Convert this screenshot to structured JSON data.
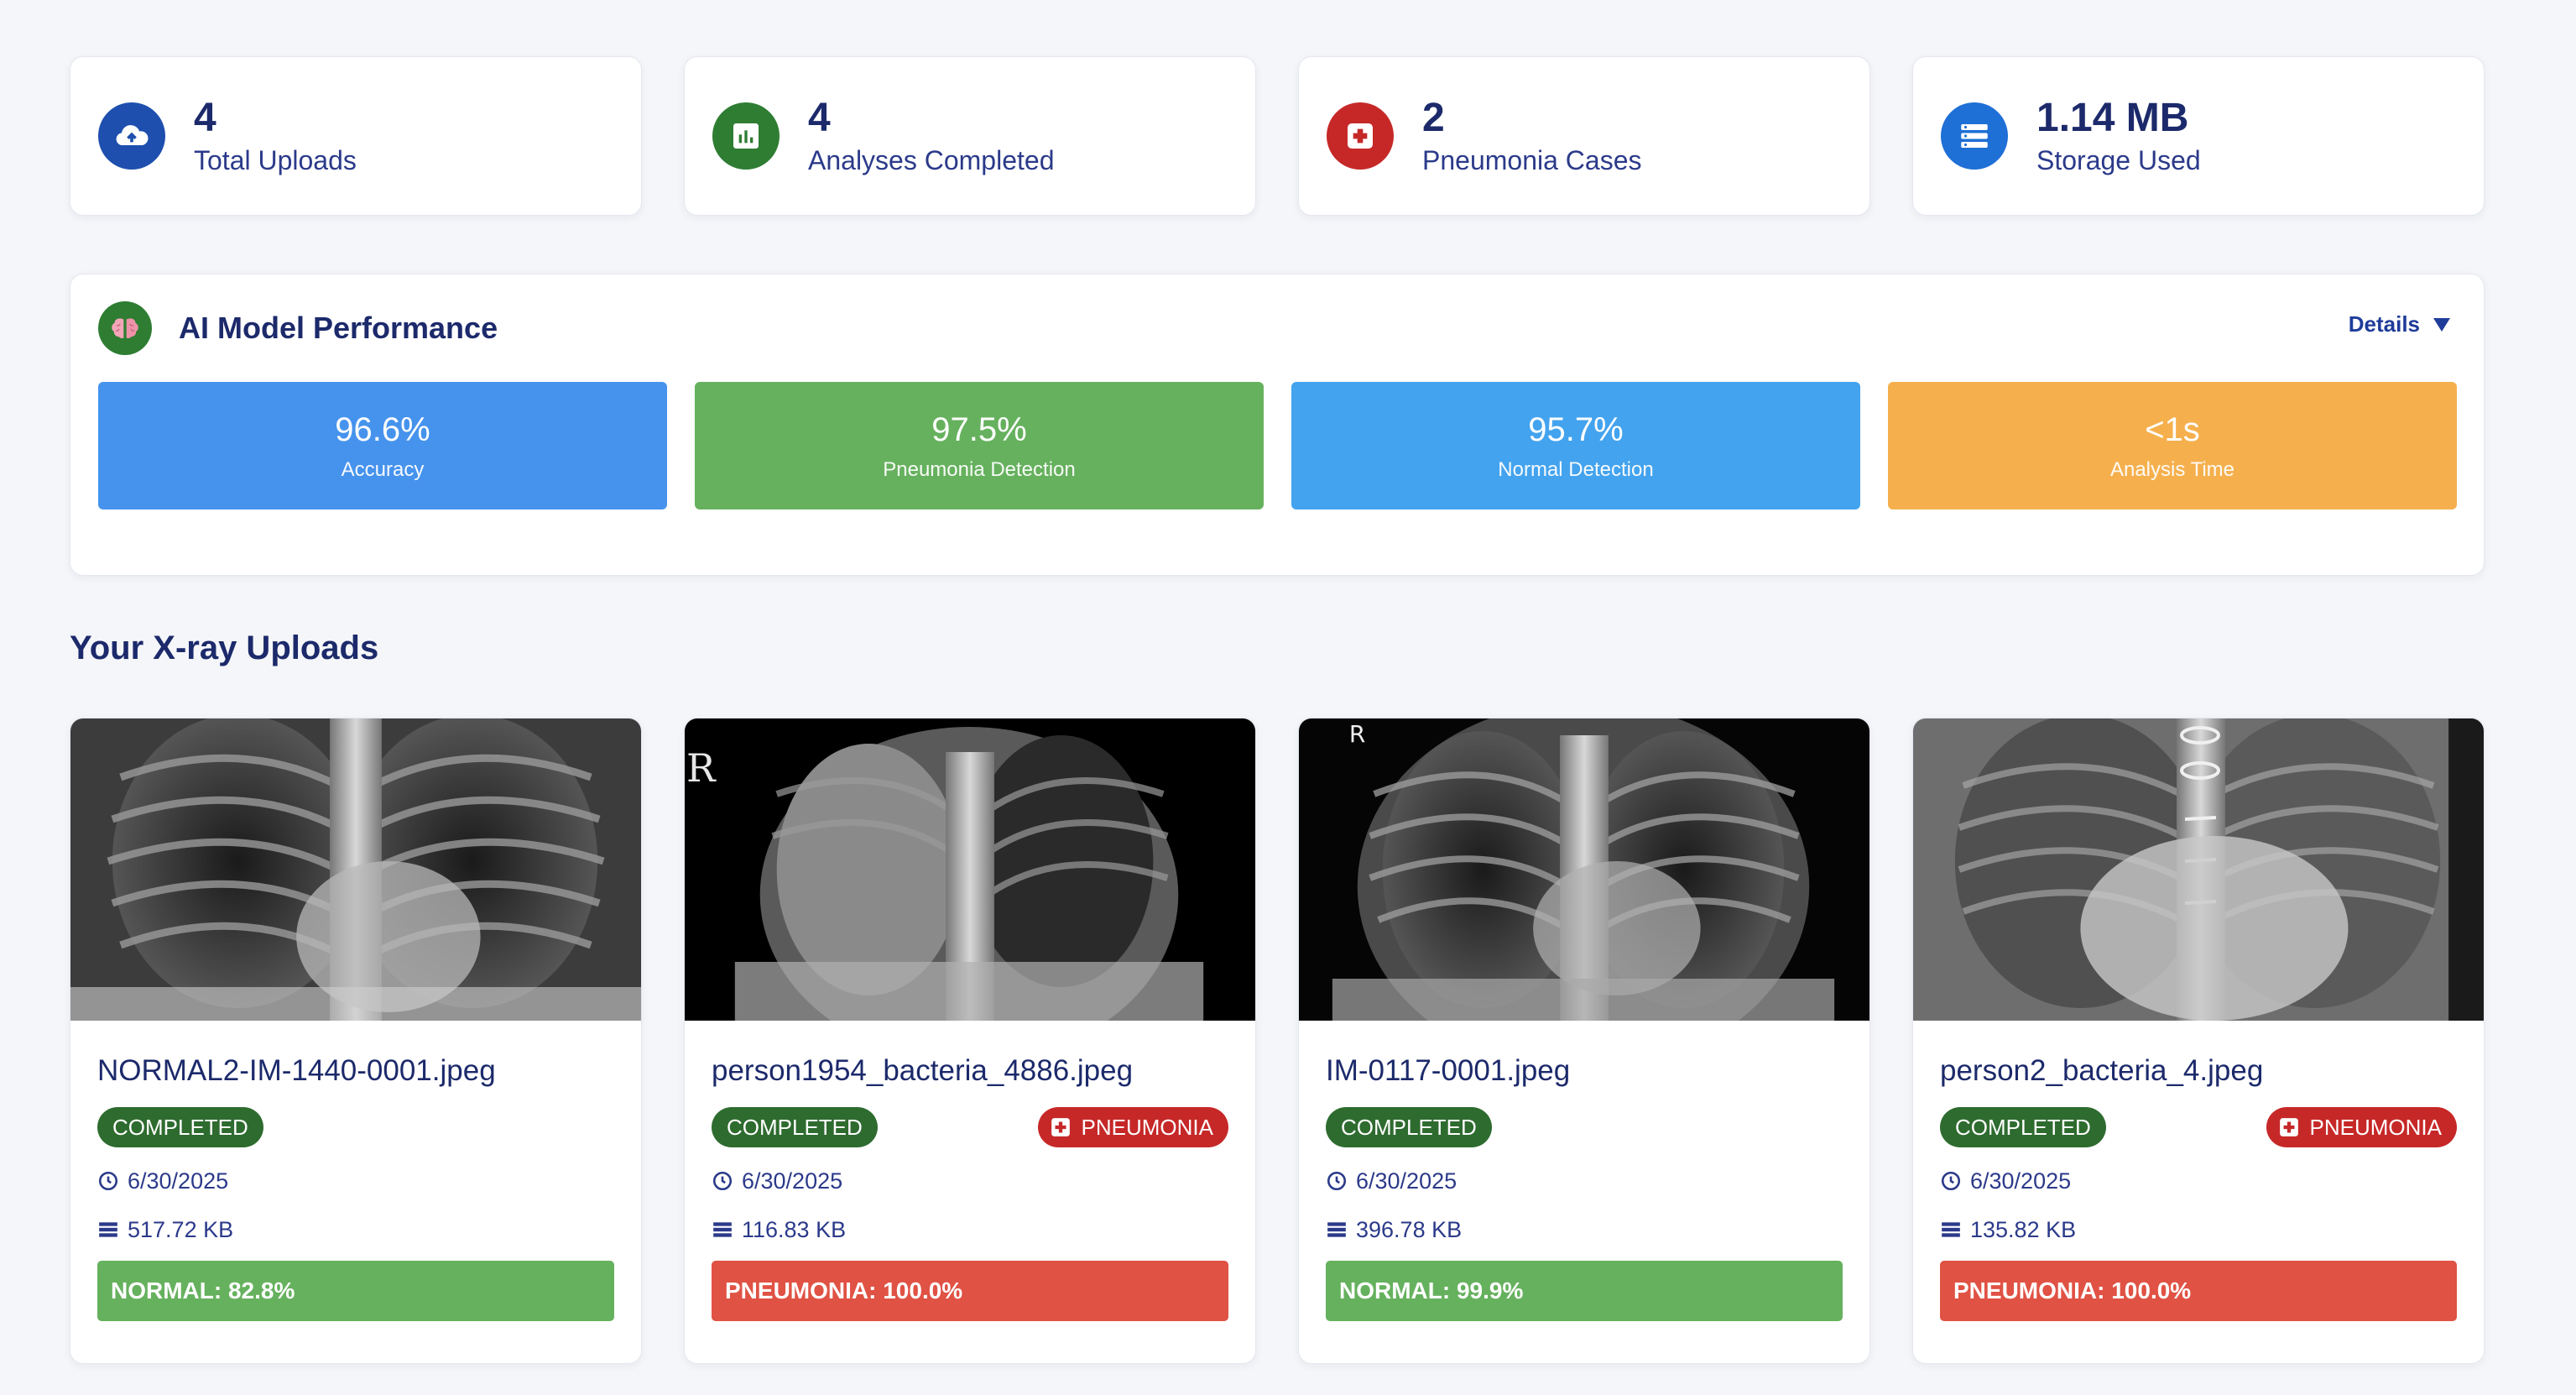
{
  "stats": [
    {
      "value": "4",
      "label": "Total Uploads",
      "icon": "cloud-upload-icon",
      "color": "#1e4fae"
    },
    {
      "value": "4",
      "label": "Analyses Completed",
      "icon": "bar-chart-icon",
      "color": "#2e7d32"
    },
    {
      "value": "2",
      "label": "Pneumonia Cases",
      "icon": "medical-cross-icon",
      "color": "#c62828"
    },
    {
      "value": "1.14 MB",
      "label": "Storage Used",
      "icon": "storage-icon",
      "color": "#1e6fd6"
    }
  ],
  "performance": {
    "title": "AI Model Performance",
    "details_label": "Details",
    "metrics": [
      {
        "value": "96.6%",
        "label": "Accuracy",
        "color": "#4693ed"
      },
      {
        "value": "97.5%",
        "label": "Pneumonia Detection",
        "color": "#66b15e"
      },
      {
        "value": "95.7%",
        "label": "Normal Detection",
        "color": "#43a3ee"
      },
      {
        "value": "<1s",
        "label": "Analysis Time",
        "color": "#f5b04d"
      }
    ]
  },
  "uploads": {
    "title": "Your X-ray Uploads",
    "items": [
      {
        "filename": "NORMAL2-IM-1440-0001.jpeg",
        "status": "COMPLETED",
        "flag": "",
        "date": "6/30/2025",
        "size": "517.72 KB",
        "result": "NORMAL: 82.8%"
      },
      {
        "filename": "person1954_bacteria_4886.jpeg",
        "status": "COMPLETED",
        "flag": "PNEUMONIA",
        "date": "6/30/2025",
        "size": "116.83 KB",
        "result": "PNEUMONIA: 100.0%"
      },
      {
        "filename": "IM-0117-0001.jpeg",
        "status": "COMPLETED",
        "flag": "",
        "date": "6/30/2025",
        "size": "396.78 KB",
        "result": "NORMAL: 99.9%"
      },
      {
        "filename": "person2_bacteria_4.jpeg",
        "status": "COMPLETED",
        "flag": "PNEUMONIA",
        "date": "6/30/2025",
        "size": "135.82 KB",
        "result": "PNEUMONIA: 100.0%"
      }
    ],
    "xray_markers": [
      "",
      "R",
      "R",
      ""
    ]
  }
}
